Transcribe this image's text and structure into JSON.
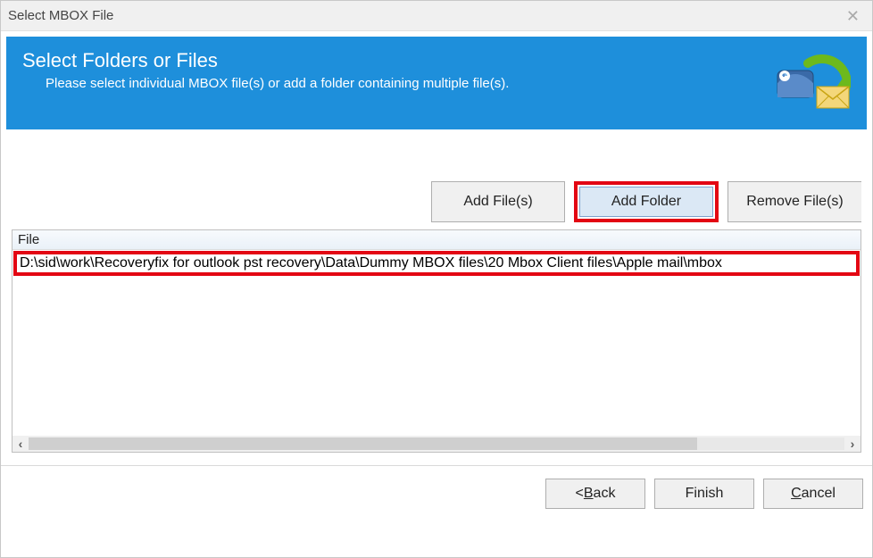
{
  "window": {
    "title": "Select MBOX File"
  },
  "banner": {
    "title": "Select Folders or Files",
    "subtitle": "Please select individual MBOX file(s) or add a folder containing multiple file(s)."
  },
  "actions": {
    "add_files": "Add File(s)",
    "add_folder": "Add Folder",
    "remove_files": "Remove File(s)"
  },
  "list": {
    "header": "File",
    "rows": [
      "D:\\sid\\work\\Recoveryfix for outlook pst recovery\\Data\\Dummy MBOX files\\20 Mbox Client files\\Apple mail\\mbox"
    ]
  },
  "footer": {
    "back": "Back",
    "back_prefix": "<",
    "finish": "Finish",
    "cancel": "Cancel"
  },
  "colors": {
    "banner": "#1e8fdb",
    "highlight_box": "#e30613"
  }
}
